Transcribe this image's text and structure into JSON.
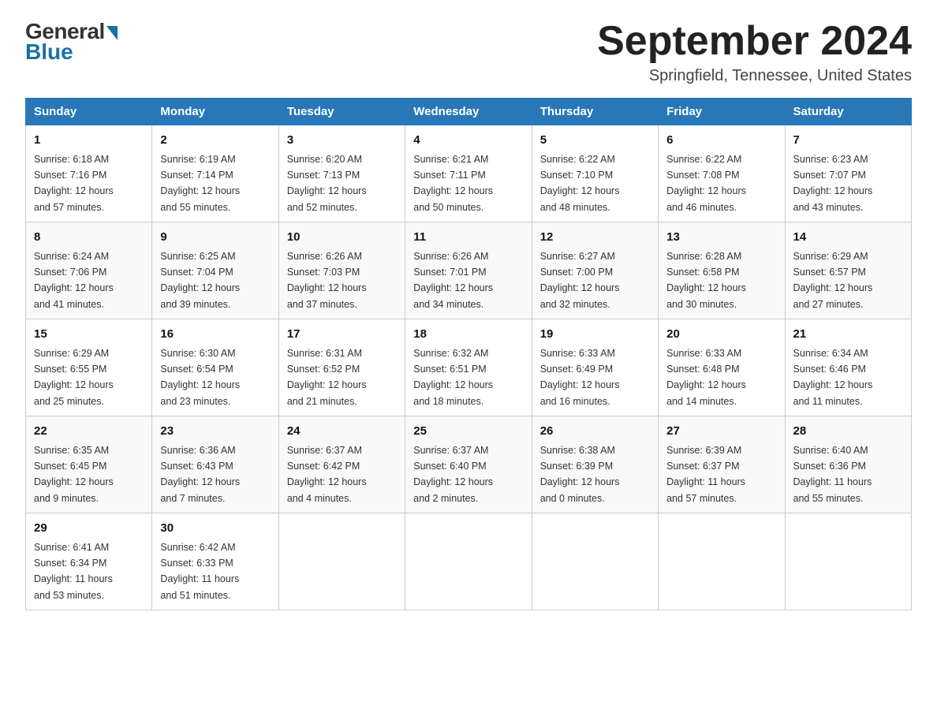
{
  "logo": {
    "general": "General",
    "blue": "Blue"
  },
  "title": {
    "month_year": "September 2024",
    "location": "Springfield, Tennessee, United States"
  },
  "days_of_week": [
    "Sunday",
    "Monday",
    "Tuesday",
    "Wednesday",
    "Thursday",
    "Friday",
    "Saturday"
  ],
  "weeks": [
    [
      {
        "day": "1",
        "sunrise": "6:18 AM",
        "sunset": "7:16 PM",
        "daylight": "12 hours and 57 minutes."
      },
      {
        "day": "2",
        "sunrise": "6:19 AM",
        "sunset": "7:14 PM",
        "daylight": "12 hours and 55 minutes."
      },
      {
        "day": "3",
        "sunrise": "6:20 AM",
        "sunset": "7:13 PM",
        "daylight": "12 hours and 52 minutes."
      },
      {
        "day": "4",
        "sunrise": "6:21 AM",
        "sunset": "7:11 PM",
        "daylight": "12 hours and 50 minutes."
      },
      {
        "day": "5",
        "sunrise": "6:22 AM",
        "sunset": "7:10 PM",
        "daylight": "12 hours and 48 minutes."
      },
      {
        "day": "6",
        "sunrise": "6:22 AM",
        "sunset": "7:08 PM",
        "daylight": "12 hours and 46 minutes."
      },
      {
        "day": "7",
        "sunrise": "6:23 AM",
        "sunset": "7:07 PM",
        "daylight": "12 hours and 43 minutes."
      }
    ],
    [
      {
        "day": "8",
        "sunrise": "6:24 AM",
        "sunset": "7:06 PM",
        "daylight": "12 hours and 41 minutes."
      },
      {
        "day": "9",
        "sunrise": "6:25 AM",
        "sunset": "7:04 PM",
        "daylight": "12 hours and 39 minutes."
      },
      {
        "day": "10",
        "sunrise": "6:26 AM",
        "sunset": "7:03 PM",
        "daylight": "12 hours and 37 minutes."
      },
      {
        "day": "11",
        "sunrise": "6:26 AM",
        "sunset": "7:01 PM",
        "daylight": "12 hours and 34 minutes."
      },
      {
        "day": "12",
        "sunrise": "6:27 AM",
        "sunset": "7:00 PM",
        "daylight": "12 hours and 32 minutes."
      },
      {
        "day": "13",
        "sunrise": "6:28 AM",
        "sunset": "6:58 PM",
        "daylight": "12 hours and 30 minutes."
      },
      {
        "day": "14",
        "sunrise": "6:29 AM",
        "sunset": "6:57 PM",
        "daylight": "12 hours and 27 minutes."
      }
    ],
    [
      {
        "day": "15",
        "sunrise": "6:29 AM",
        "sunset": "6:55 PM",
        "daylight": "12 hours and 25 minutes."
      },
      {
        "day": "16",
        "sunrise": "6:30 AM",
        "sunset": "6:54 PM",
        "daylight": "12 hours and 23 minutes."
      },
      {
        "day": "17",
        "sunrise": "6:31 AM",
        "sunset": "6:52 PM",
        "daylight": "12 hours and 21 minutes."
      },
      {
        "day": "18",
        "sunrise": "6:32 AM",
        "sunset": "6:51 PM",
        "daylight": "12 hours and 18 minutes."
      },
      {
        "day": "19",
        "sunrise": "6:33 AM",
        "sunset": "6:49 PM",
        "daylight": "12 hours and 16 minutes."
      },
      {
        "day": "20",
        "sunrise": "6:33 AM",
        "sunset": "6:48 PM",
        "daylight": "12 hours and 14 minutes."
      },
      {
        "day": "21",
        "sunrise": "6:34 AM",
        "sunset": "6:46 PM",
        "daylight": "12 hours and 11 minutes."
      }
    ],
    [
      {
        "day": "22",
        "sunrise": "6:35 AM",
        "sunset": "6:45 PM",
        "daylight": "12 hours and 9 minutes."
      },
      {
        "day": "23",
        "sunrise": "6:36 AM",
        "sunset": "6:43 PM",
        "daylight": "12 hours and 7 minutes."
      },
      {
        "day": "24",
        "sunrise": "6:37 AM",
        "sunset": "6:42 PM",
        "daylight": "12 hours and 4 minutes."
      },
      {
        "day": "25",
        "sunrise": "6:37 AM",
        "sunset": "6:40 PM",
        "daylight": "12 hours and 2 minutes."
      },
      {
        "day": "26",
        "sunrise": "6:38 AM",
        "sunset": "6:39 PM",
        "daylight": "12 hours and 0 minutes."
      },
      {
        "day": "27",
        "sunrise": "6:39 AM",
        "sunset": "6:37 PM",
        "daylight": "11 hours and 57 minutes."
      },
      {
        "day": "28",
        "sunrise": "6:40 AM",
        "sunset": "6:36 PM",
        "daylight": "11 hours and 55 minutes."
      }
    ],
    [
      {
        "day": "29",
        "sunrise": "6:41 AM",
        "sunset": "6:34 PM",
        "daylight": "11 hours and 53 minutes."
      },
      {
        "day": "30",
        "sunrise": "6:42 AM",
        "sunset": "6:33 PM",
        "daylight": "11 hours and 51 minutes."
      },
      null,
      null,
      null,
      null,
      null
    ]
  ],
  "labels": {
    "sunrise": "Sunrise:",
    "sunset": "Sunset:",
    "daylight": "Daylight:"
  }
}
